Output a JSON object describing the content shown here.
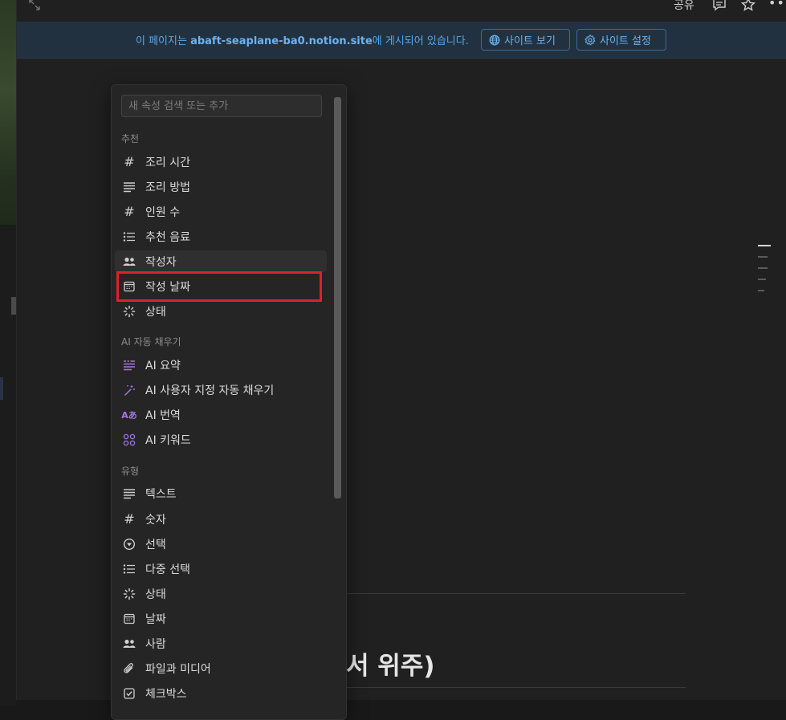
{
  "topbar": {
    "share_label": "공유"
  },
  "banner": {
    "text_before": "이 페이지는 ",
    "site_url": "abaft-seaplane-ba0.notion.site",
    "text_after": "에 게시되어 있습니다.",
    "view_site_label": "사이트 보기",
    "site_settings_label": "사이트 설정"
  },
  "page": {
    "heading_fragment": "서 위주)"
  },
  "menu": {
    "search_placeholder": "새 속성 검색 또는 추가",
    "sections": {
      "suggested": "추천",
      "ai_autofill": "AI 자동 채우기",
      "types": "유형"
    },
    "suggested_items": [
      {
        "label": "조리 시간",
        "icon": "hash-icon"
      },
      {
        "label": "조리 방법",
        "icon": "text-lines-icon"
      },
      {
        "label": "인원 수",
        "icon": "hash-icon"
      },
      {
        "label": "추천 음료",
        "icon": "bulleted-list-icon"
      },
      {
        "label": "작성자",
        "icon": "people-icon"
      },
      {
        "label": "작성 날짜",
        "icon": "calendar-icon"
      },
      {
        "label": "상태",
        "icon": "status-icon"
      }
    ],
    "ai_items": [
      {
        "label": "AI 요약",
        "icon": "ai-summary-icon"
      },
      {
        "label": "AI 사용자 지정 자동 채우기",
        "icon": "magic-wand-icon"
      },
      {
        "label": "AI 번역",
        "icon": "translate-icon"
      },
      {
        "label": "AI 키워드",
        "icon": "keywords-icon"
      }
    ],
    "type_items": [
      {
        "label": "텍스트",
        "icon": "text-lines-icon"
      },
      {
        "label": "숫자",
        "icon": "hash-icon"
      },
      {
        "label": "선택",
        "icon": "select-icon"
      },
      {
        "label": "다중 선택",
        "icon": "bulleted-list-icon"
      },
      {
        "label": "상태",
        "icon": "status-icon"
      },
      {
        "label": "날짜",
        "icon": "calendar-icon"
      },
      {
        "label": "사람",
        "icon": "people-icon"
      },
      {
        "label": "파일과 미디어",
        "icon": "paperclip-icon"
      },
      {
        "label": "체크박스",
        "icon": "checkbox-icon"
      }
    ]
  },
  "colors": {
    "highlight": "#e0202a",
    "banner_accent": "#58a6e8",
    "ai_purple": "#a877e0"
  }
}
